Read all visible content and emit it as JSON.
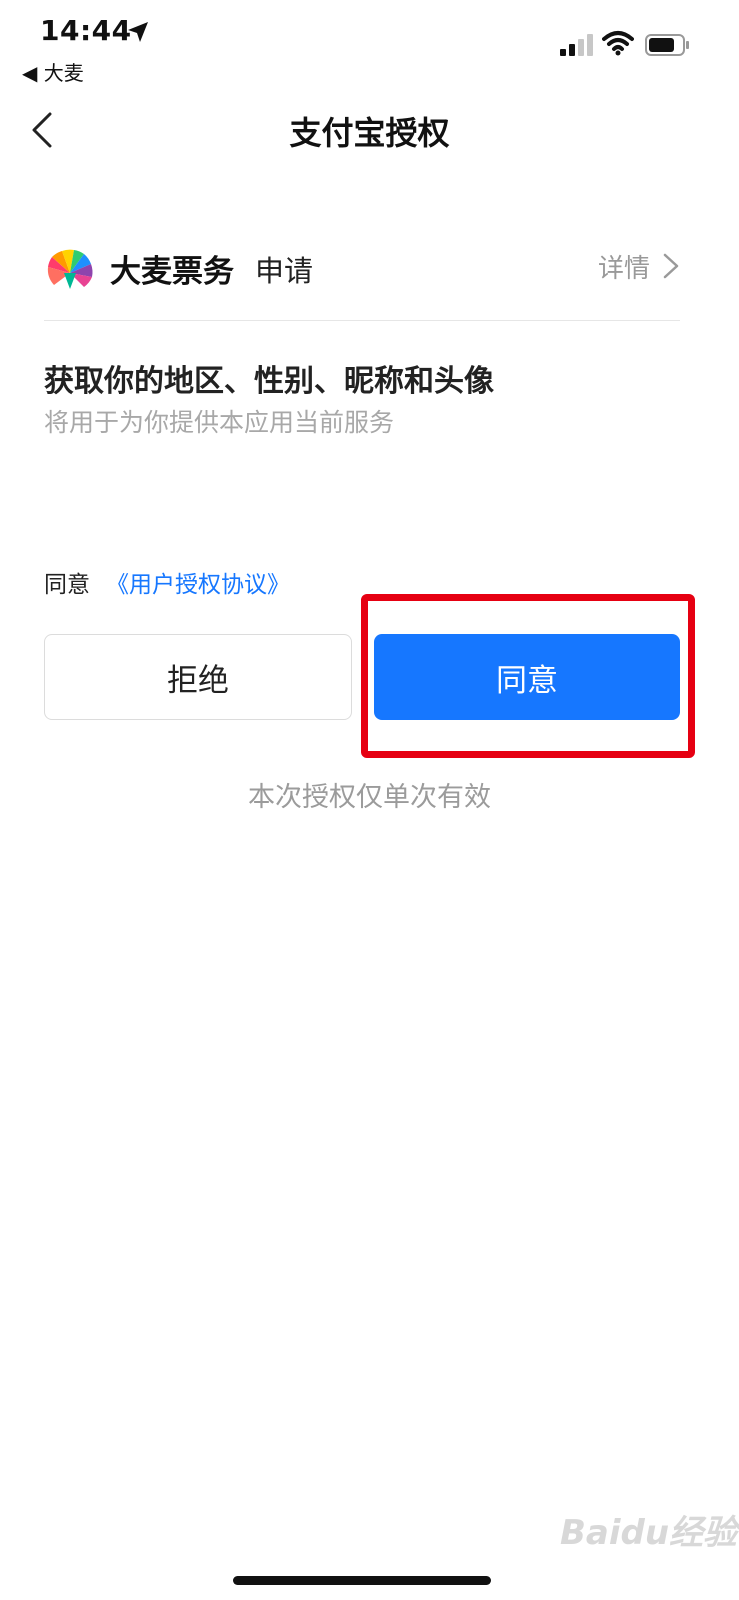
{
  "status_bar": {
    "time": "14:44",
    "back_app": "◀ 大麦"
  },
  "nav": {
    "title": "支付宝授权"
  },
  "app": {
    "name": "大麦票务",
    "request": "申请",
    "detail": "详情"
  },
  "permission": {
    "title": "获取你的地区、性别、昵称和头像",
    "subtitle": "将用于为你提供本应用当前服务"
  },
  "agreement": {
    "prefix": "同意",
    "link": "《用户授权协议》"
  },
  "buttons": {
    "reject": "拒绝",
    "agree": "同意"
  },
  "note": "本次授权仅单次有效",
  "watermark": "Baidu经验",
  "colors": {
    "accent": "#1677ff",
    "highlight": "#e60012"
  }
}
